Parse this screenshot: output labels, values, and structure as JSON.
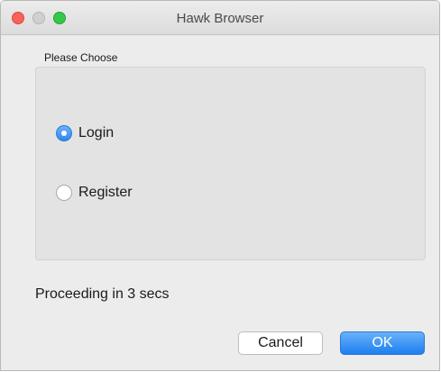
{
  "window": {
    "title": "Hawk Browser"
  },
  "group": {
    "label": "Please Choose",
    "options": [
      {
        "label": "Login",
        "selected": true
      },
      {
        "label": "Register",
        "selected": false
      }
    ]
  },
  "status": {
    "text": "Proceeding in 3 secs"
  },
  "buttons": {
    "cancel_label": "Cancel",
    "ok_label": "OK"
  },
  "colors": {
    "accent": "#2e87f0",
    "close": "#fc605c",
    "zoom": "#34c84a",
    "window_bg": "#ececec"
  }
}
